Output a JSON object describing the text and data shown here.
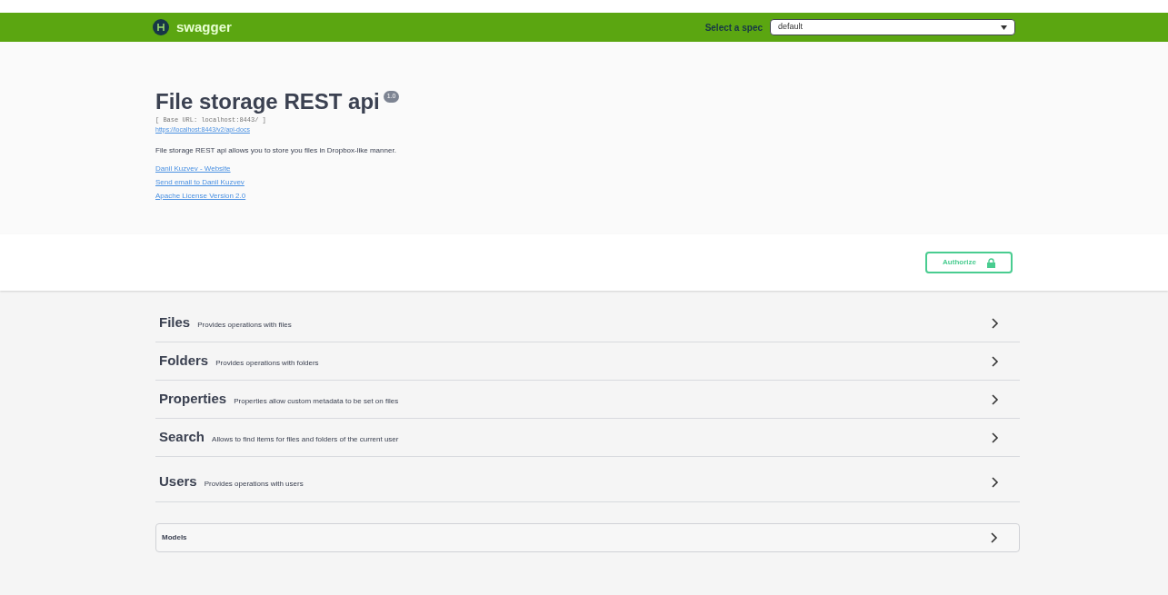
{
  "topbar": {
    "brand": "swagger",
    "spec_label": "Select a spec",
    "spec_value": "default"
  },
  "info": {
    "title": "File storage REST api",
    "version": "1.0",
    "base_url": "[ Base URL: localhost:8443/ ]",
    "docs_link": "https://localhost:8443/v2/api-docs",
    "description": "File storage REST api allows you to store you files in Dropbox-like manner.",
    "links": [
      "Danil Kuzvev - Website",
      "Send email to Danil Kuzvev",
      "Apache License Version 2.0"
    ]
  },
  "authorize_button": "Authorize",
  "tags": [
    {
      "name": "Files",
      "description": "Provides operations with files",
      "expanded": false
    },
    {
      "name": "Folders",
      "description": "Provides operations with folders",
      "expanded": false
    },
    {
      "name": "Properties",
      "description": "Properties allow custom metadata to be set on files",
      "expanded": false
    },
    {
      "name": "Search",
      "description": "Allows to find items for files and folders of the current user",
      "expanded": false
    },
    {
      "name": "Users",
      "description": "Provides operations with users",
      "expanded": false
    }
  ],
  "models": {
    "title": "Models",
    "expanded": false
  }
}
